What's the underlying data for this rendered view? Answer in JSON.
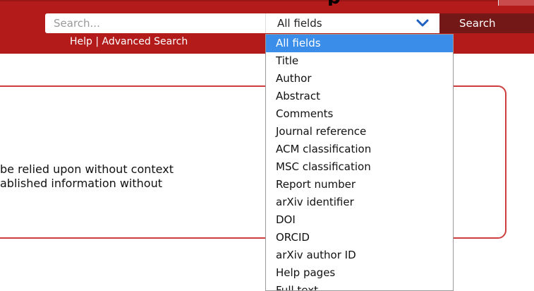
{
  "header": {
    "title_fragment": "p",
    "search": {
      "placeholder": "Search...",
      "value": ""
    },
    "field_select": {
      "selected": "All fields"
    },
    "search_button_label": "Search",
    "help_link": "Help",
    "separator": "|",
    "advanced_search_link": "Advanced Search"
  },
  "notice": {
    "line1": "be relied upon without context",
    "line2": "ablished information without"
  },
  "dropdown": {
    "options": [
      "All fields",
      "Title",
      "Author",
      "Abstract",
      "Comments",
      "Journal reference",
      "ACM classification",
      "MSC classification",
      "Report number",
      "arXiv identifier",
      "DOI",
      "ORCID",
      "arXiv author ID",
      "Help pages",
      "Full text"
    ],
    "selected_index": 0
  },
  "colors": {
    "header_red": "#b31b1b",
    "button_dark_red": "#741717",
    "selected_blue": "#3a8eea",
    "notice_border": "#cd3e3e"
  }
}
